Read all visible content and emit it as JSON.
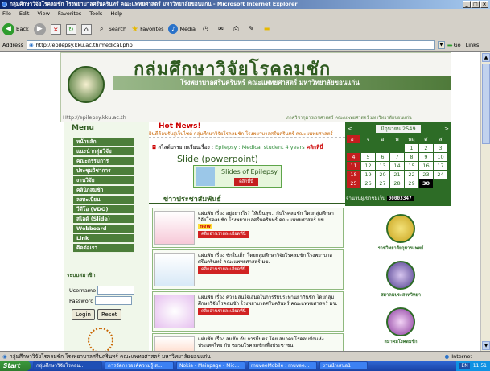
{
  "window": {
    "title": "กลุ่มศึกษาวิจัยโรคลมชัก โรงพยาบาลศรีนครินทร์ คณะแพทยศาสตร์ มหาวิทยาลัยขอนแก่น - Microsoft Internet Explorer"
  },
  "menubar": [
    "File",
    "Edit",
    "View",
    "Favorites",
    "Tools",
    "Help"
  ],
  "toolbar": {
    "back": "Back",
    "search": "Search",
    "favorites": "Favorites",
    "media": "Media"
  },
  "address": {
    "label": "Address",
    "url": "http://epilepsy.kku.ac.th/medical.php",
    "go": "Go",
    "links": "Links"
  },
  "header": {
    "title": "กลุ่มศึกษาวิจัยโรคลมชัก",
    "band": "โรงพยาบาลศรีนครินทร์ คณะแพทยศาสตร์ มหาวิทยาลัยขอนแก่น",
    "url": "Http://epilepsy.kku.ac.th",
    "sub": "ภาควิชากุมารเวชศาสตร์ คณะแพทยศาสตร์ มหาวิทยาลัยขอนแก่น"
  },
  "menu": {
    "title": "Menu",
    "items": [
      "หน้าหลัก",
      "แนะนำกลุ่มวิจัย",
      "คณะกรรมการ",
      "ประชุมวิชาการ",
      "งานวิจัย",
      "คลินิกลมชัก",
      "ลงทะเบียน",
      "วีดีโอ (VDO)",
      "สไลด์ (Slide)",
      "Webboard",
      "Link",
      "ติดต่อเรา"
    ]
  },
  "login": {
    "header": "ระบบสมาชิก",
    "username": "Username",
    "password": "Password",
    "login": "Login",
    "reset": "Reset"
  },
  "hotnews": {
    "label": "Hot News!",
    "ticker": "ยินดีต้อนรับสู่เว็บไซต์ กลุ่มศึกษาวิจัยโรคลมชัก โรงพยาบาลศรีนครินทร์ คณะแพทยศาสตร์"
  },
  "study": {
    "prefix": "สไลด์บรรยายเรียนเรื่อง :",
    "topic": "Epilepsy : Medical student 4 years",
    "click": "คลิกที่นี่"
  },
  "slide": {
    "title": "Slide (powerpoint)",
    "caption": "Slides of Epilepsy",
    "more": "คลิกที่นี่"
  },
  "news": {
    "header": "ข่าวประชาสัมพันธ์",
    "items": [
      {
        "text": "แผ่นพับ เรื่อง อยู่อย่างไร? ให้เป็นสุข.. กับโรคลมชัก โดยกลุ่มศึกษาวิจัยโรคลมชัก โรงพยาบาลศรีนครินทร์ คณะแพทยศาสตร์ มข.",
        "badge": "new",
        "more": "คลิกอ่านรายละเอียดที่นี่"
      },
      {
        "text": "แผ่นพับ เรื่อง ชักในเด็ก โดยกลุ่มศึกษาวิจัยโรคลมชัก โรงพยาบาลศรีนครินทร์ คณะแพทยศาสตร์ มข.",
        "badge": "",
        "more": "คลิกอ่านรายละเอียดที่นี่"
      },
      {
        "text": "แผ่นพับ เรื่อง ความสนใจเสมอในการรับประทานยากันชัก โดยกลุ่มศึกษาวิจัยโรคลมชัก โรงพยาบาลศรีนครินทร์ คณะแพทยศาสตร์ มข.",
        "badge": "",
        "more": "คลิกอ่านรายละเอียดที่นี่"
      },
      {
        "text": "แผ่นพับ เรื่อง ลมชัก กับ การมีบุตร โดย สมาคมโรคลมชักแห่งประเทศไทย กับ ชมรมโรคลมชักเพื่อประชาชน",
        "badge": "",
        "more": ""
      }
    ]
  },
  "calendar": {
    "month": "มิถุนายน 2549",
    "prev": "<",
    "next": ">",
    "days": [
      "อา",
      "จ",
      "อ",
      "พ",
      "พฤ",
      "ศ",
      "ส"
    ],
    "cells": [
      "",
      "",
      "",
      "",
      "1",
      "2",
      "3",
      "4",
      "5",
      "6",
      "7",
      "8",
      "9",
      "10",
      "11",
      "12",
      "13",
      "14",
      "15",
      "16",
      "17",
      "18",
      "19",
      "20",
      "21",
      "22",
      "23",
      "24",
      "25",
      "26",
      "27",
      "28",
      "29",
      "30",
      ""
    ],
    "today": "30",
    "counter_label": "จำนวนผู้เข้าชมเว็บ",
    "counter": "00003347"
  },
  "partners": [
    "ราชวิทยาลัยกุมารแพทย์",
    "สมาคมประสาทวิทยา",
    "สมาคมโรคลมชัก"
  ],
  "status": {
    "text": "กลุ่มศึกษาวิจัยโรคลมชัก โรงพยาบาลศรีนครินทร์ คณะแพทยศาสตร์ มหาวิทยาลัยขอนแก่น",
    "zone": "Internet"
  },
  "taskbar": {
    "start": "Start",
    "tasks": [
      "กลุ่มศึกษาวิจัยโรคลม...",
      "การจัดการองค์ความรู้ ส...",
      "Nokia - Mainpage - Mic...",
      "muveeMobile : muvee...",
      "งานนำเสนอ1"
    ],
    "lang": "EN",
    "clock": "11:51"
  }
}
